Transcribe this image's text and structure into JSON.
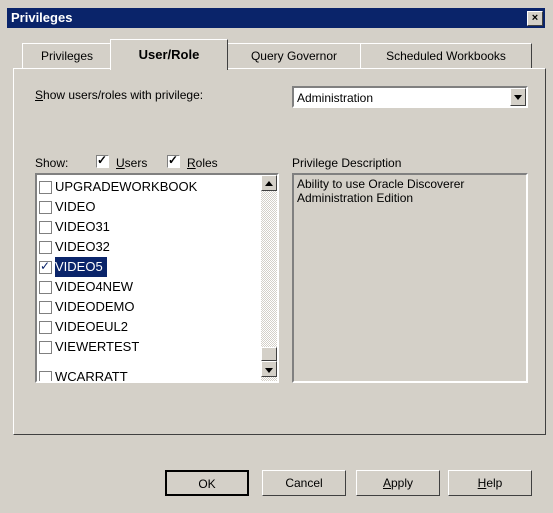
{
  "window": {
    "title": "Privileges"
  },
  "tabs": [
    "Privileges",
    "User/Role",
    "Query Governor",
    "Scheduled Workbooks"
  ],
  "active_tab": "User/Role",
  "privilege_select": {
    "label_prefix": "S",
    "label_rest": "how users/roles with privilege:",
    "value": "Administration"
  },
  "show": {
    "label": "Show:",
    "users_u": "U",
    "users_rest": "sers",
    "users_checked": true,
    "roles_u": "R",
    "roles_rest": "oles",
    "roles_checked": true
  },
  "users_list": [
    {
      "name": "UPGRADEWORKBOOK",
      "checked": false
    },
    {
      "name": "VIDEO",
      "checked": false
    },
    {
      "name": "VIDEO31",
      "checked": false
    },
    {
      "name": "VIDEO32",
      "checked": false
    },
    {
      "name": "VIDEO5",
      "checked": true,
      "selected": true
    },
    {
      "name": "VIDEO4NEW",
      "checked": false
    },
    {
      "name": "VIDEODEMO",
      "checked": false
    },
    {
      "name": "VIDEOEUL2",
      "checked": false
    },
    {
      "name": "VIEWERTEST",
      "checked": false
    },
    {
      "name": "WCARRATT",
      "checked": false
    }
  ],
  "description": {
    "label": "Privilege Description",
    "text": "Ability to use Oracle Discoverer Administration Edition"
  },
  "buttons": {
    "ok": "OK",
    "cancel": "Cancel",
    "apply_u": "A",
    "apply_rest": "pply",
    "help_u": "H",
    "help_rest": "elp"
  }
}
